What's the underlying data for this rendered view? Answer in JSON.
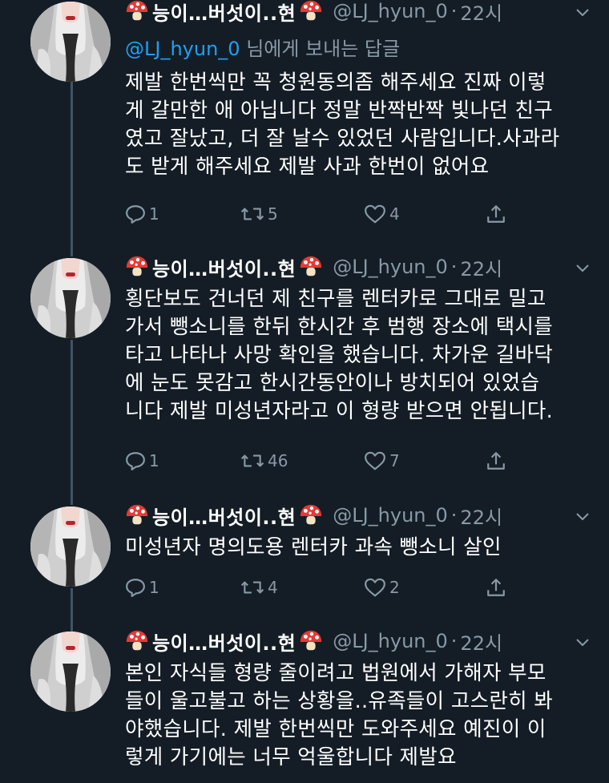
{
  "tweets": [
    {
      "name": "능이…버섯이..현",
      "handle": "@LJ_hyun_0",
      "dot": "·",
      "time": "22시",
      "reply_mention": "@LJ_hyun_0",
      "reply_suffix": " 님에게 보내는 답글",
      "text": "제발 한번씩만 꼭 청원동의좀 해주세요 진짜 이렇\n게 갈만한 애 아닙니다 정말 반짝반짝 빛나던 친구\n였고 잘났고, 더 잘 날수 있었던 사람입니다.사과라\n도 받게 해주세요 제발 사과 한번이 없어요",
      "replies": "1",
      "retweets": "5",
      "likes": "4"
    },
    {
      "name": "능이…버섯이..현",
      "handle": "@LJ_hyun_0",
      "dot": "·",
      "time": "22시",
      "text": "횡단보도 건너던 제 친구를 렌터카로 그대로 밀고\n가서 뺑소니를 한뒤 한시간 후 범행 장소에 택시를\n타고 나타나 사망 확인을 했습니다. 차가운 길바닥\n에 눈도 못감고 한시간동안이나 방치되어 있었습\n니다 제발 미성년자라고 이 형량 받으면 안됩니다.",
      "replies": "1",
      "retweets": "46",
      "likes": "7"
    },
    {
      "name": "능이…버섯이..현",
      "handle": "@LJ_hyun_0",
      "dot": "·",
      "time": "22시",
      "text": "미성년자 명의도용 렌터카 과속 뺑소니 살인",
      "replies": "1",
      "retweets": "4",
      "likes": "2"
    },
    {
      "name": "능이…버섯이..현",
      "handle": "@LJ_hyun_0",
      "dot": "·",
      "time": "22시",
      "text": "본인 자식들 형량 줄이려고 법원에서 가해자 부모\n들이 울고불고 하는 상황을..유족들이 고스란히 봐\n야했습니다. 제발 한번씩만 도와주세요 예진이 이\n렇게 가기에는 너무 억울합니다 제발요"
    }
  ],
  "icons": {
    "mushroom": "mushroom-icon",
    "reply": "reply-icon",
    "retweet": "retweet-icon",
    "like": "heart-icon",
    "share": "share-icon",
    "more": "chevron-down-icon"
  },
  "colors": {
    "background": "#141d26",
    "secondary_text": "#8899a6",
    "mention": "#1da1f2",
    "thread_line": "#3d5466"
  }
}
